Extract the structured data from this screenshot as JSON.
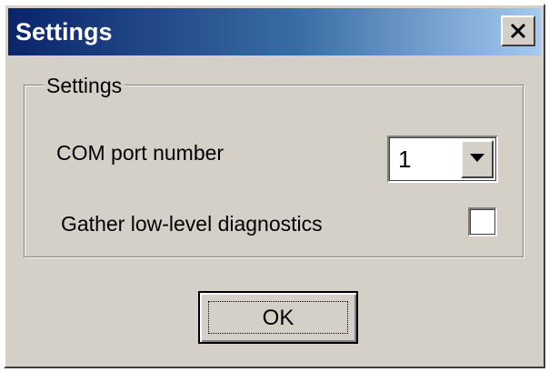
{
  "window": {
    "title": "Settings",
    "close_icon": "close-icon"
  },
  "group": {
    "legend": "Settings"
  },
  "com_port": {
    "label": "COM port number",
    "value": "1",
    "dropdown_icon": "chevron-down-icon"
  },
  "diagnostics": {
    "label": "Gather low-level diagnostics",
    "checked": false
  },
  "buttons": {
    "ok_label": "OK"
  },
  "colors": {
    "face": "#d4d0c8",
    "title_start": "#0a246a",
    "title_end": "#a6caf0"
  }
}
